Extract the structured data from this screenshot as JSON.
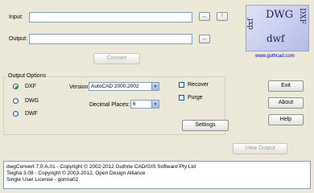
{
  "input": {
    "label": "Input:",
    "value": "",
    "browse_label": "...",
    "extra_label": "!"
  },
  "output": {
    "label": "Output:",
    "value": "",
    "browse_label": "..."
  },
  "convert_label": "Convert",
  "logo": {
    "dwg_text": "DWG",
    "dxf_text": "DXF",
    "dxf_rotated_text": "dxf",
    "dwf_text": "dwf",
    "url": "www.guthcad.com",
    "colors": {
      "text": "#1d1d5a",
      "url": "#0000cc"
    }
  },
  "output_options": {
    "title": "Output Options",
    "formats": [
      {
        "label": "DXF",
        "selected": true
      },
      {
        "label": "DWG",
        "selected": false
      },
      {
        "label": "DWF",
        "selected": false
      }
    ],
    "version_label": "Version:",
    "version_value": "AutoCAD 2000,2002",
    "decimal_label": "Decimal Places:",
    "decimal_value": "6",
    "recover_label": "Recover",
    "purge_label": "Purge",
    "settings_label": "Settings"
  },
  "side_buttons": {
    "exit": "Exit",
    "about": "About",
    "help": "Help"
  },
  "view_output_label": "View Output",
  "status_lines": [
    "dwgConvert 7.0.A.01 - Copyright © 2002-2012 Guthrie CAD/GIS Software Pty Ltd",
    "Teigha 3.08 - Copyright © 2003-2012, Open Design Alliance",
    "",
    "Single User License - gorma02"
  ]
}
